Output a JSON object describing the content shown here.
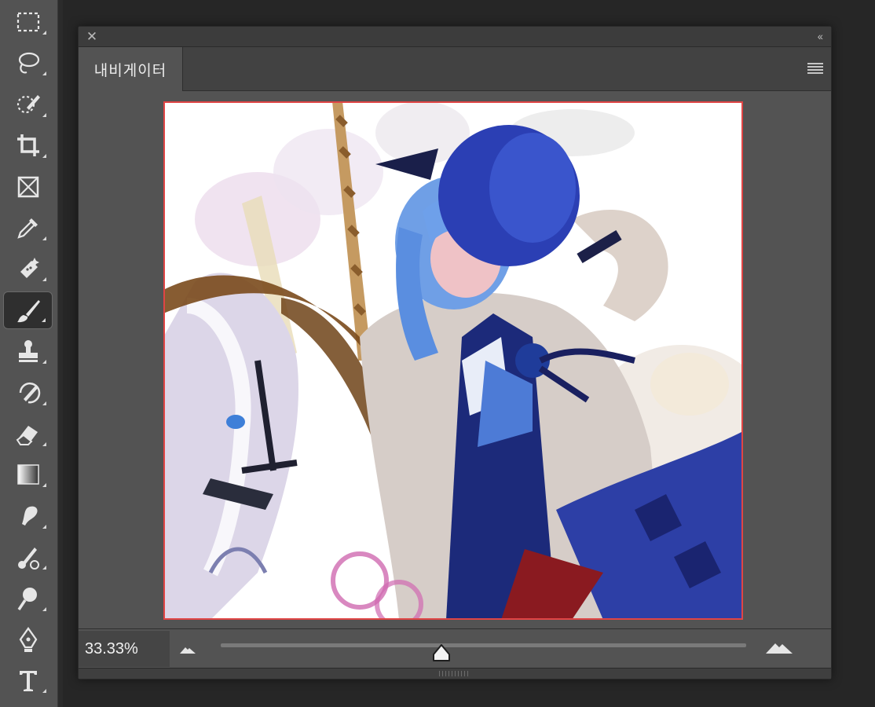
{
  "toolbar": {
    "tools": [
      {
        "name": "rectangular-marquee-tool",
        "icon": "marquee-icon",
        "active": false
      },
      {
        "name": "lasso-tool",
        "icon": "lasso-icon",
        "active": false
      },
      {
        "name": "quick-selection-tool",
        "icon": "quick-selection-icon",
        "active": false
      },
      {
        "name": "crop-tool",
        "icon": "crop-icon",
        "active": false
      },
      {
        "name": "frame-tool",
        "icon": "frame-icon",
        "active": false
      },
      {
        "name": "eyedropper-tool",
        "icon": "eyedropper-icon",
        "active": false
      },
      {
        "name": "spot-healing-tool",
        "icon": "bandage-icon",
        "active": false
      },
      {
        "name": "brush-tool",
        "icon": "brush-icon",
        "active": true
      },
      {
        "name": "clone-stamp-tool",
        "icon": "stamp-icon",
        "active": false
      },
      {
        "name": "history-brush-tool",
        "icon": "history-brush-icon",
        "active": false
      },
      {
        "name": "eraser-tool",
        "icon": "eraser-icon",
        "active": false
      },
      {
        "name": "gradient-tool",
        "icon": "gradient-icon",
        "active": false
      },
      {
        "name": "smudge-tool",
        "icon": "smudge-icon",
        "active": false
      },
      {
        "name": "mixer-brush-tool",
        "icon": "mixer-brush-icon",
        "active": false
      },
      {
        "name": "dodge-tool",
        "icon": "dodge-icon",
        "active": false
      },
      {
        "name": "pen-tool",
        "icon": "pen-icon",
        "active": false
      },
      {
        "name": "type-tool",
        "icon": "type-icon",
        "active": false
      }
    ]
  },
  "panel": {
    "tab_label": "내비게이터",
    "close_icon": "close-icon",
    "collapse_icon": "double-chevron-left-icon",
    "menu_icon": "hamburger-icon",
    "view_box_color": "#e04545"
  },
  "zoom": {
    "value_text": "33.33%",
    "slider_position_fraction": 0.42
  }
}
